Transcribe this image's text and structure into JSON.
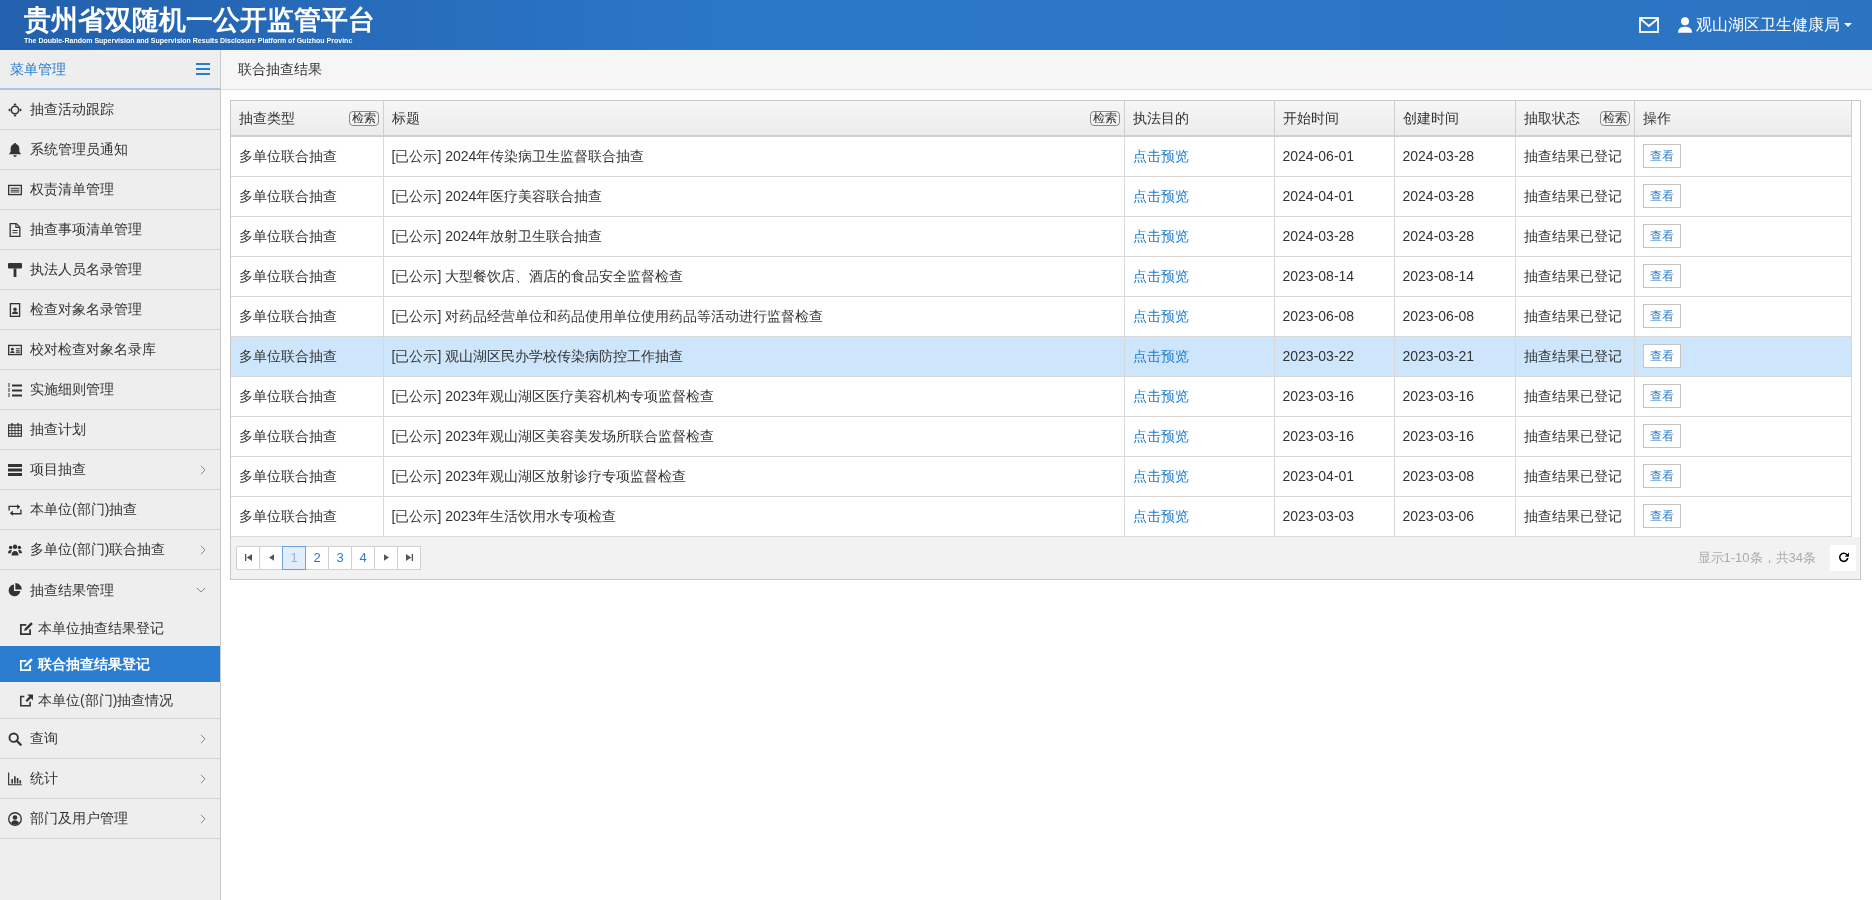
{
  "header": {
    "title": "贵州省双随机一公开监管平台",
    "subtitle": "The Double-Random Supervision and Supervision Results Disclosure Platform of Guizhou Provinc",
    "user": "观山湖区卫生健康局"
  },
  "sidebar": {
    "title": "菜单管理",
    "items": [
      {
        "kind": "link",
        "label": "抽查活动跟踪",
        "selected": false
      },
      {
        "kind": "link",
        "label": "系统管理员通知",
        "selected": false
      },
      {
        "kind": "link",
        "label": "权责清单管理",
        "selected": false
      },
      {
        "kind": "link",
        "label": "抽查事项清单管理",
        "selected": false
      },
      {
        "kind": "link",
        "label": "执法人员名录管理",
        "selected": false
      },
      {
        "kind": "link",
        "label": "检查对象名录管理",
        "selected": false
      },
      {
        "kind": "link",
        "label": "校对检查对象名录库",
        "selected": false
      },
      {
        "kind": "link",
        "label": "实施细则管理",
        "selected": false
      },
      {
        "kind": "link",
        "label": "抽查计划",
        "selected": false
      },
      {
        "kind": "group",
        "label": "项目抽查",
        "selected": false,
        "expanded": false
      },
      {
        "kind": "link",
        "label": "本单位(部门)抽查",
        "selected": false
      },
      {
        "kind": "group",
        "label": "多单位(部门)联合抽查",
        "selected": false,
        "expanded": false
      },
      {
        "kind": "group",
        "label": "抽查结果管理",
        "selected": false,
        "expanded": true,
        "children": [
          {
            "label": "本单位抽查结果登记",
            "selected": false
          },
          {
            "label": "联合抽查结果登记",
            "selected": true
          },
          {
            "label": "本单位(部门)抽查情况",
            "selected": false
          }
        ]
      },
      {
        "kind": "group",
        "label": "查询",
        "selected": false,
        "expanded": false
      },
      {
        "kind": "group",
        "label": "统计",
        "selected": false,
        "expanded": false
      },
      {
        "kind": "group",
        "label": "部门及用户管理",
        "selected": false,
        "expanded": false
      }
    ]
  },
  "breadcrumb": "联合抽查结果",
  "table": {
    "columns": [
      {
        "label": "抽查类型",
        "kind": "text",
        "filter": "检索"
      },
      {
        "label": "标题",
        "kind": "text",
        "filter": "检索"
      },
      {
        "label": "执法目的",
        "kind": "link"
      },
      {
        "label": "开始时间",
        "kind": "text"
      },
      {
        "label": "创建时间",
        "kind": "text"
      },
      {
        "label": "抽取状态",
        "kind": "text",
        "filter": "检索"
      },
      {
        "label": "操作",
        "kind": "button"
      }
    ],
    "rows": [
      {
        "cells": [
          "多单位联合抽查",
          "[已公示] 2024年传染病卫生监督联合抽查",
          "点击预览",
          "2024-06-01",
          "2024-03-28",
          "抽查结果已登记",
          "查看"
        ],
        "selected": false
      },
      {
        "cells": [
          "多单位联合抽查",
          "[已公示] 2024年医疗美容联合抽查",
          "点击预览",
          "2024-04-01",
          "2024-03-28",
          "抽查结果已登记",
          "查看"
        ],
        "selected": false
      },
      {
        "cells": [
          "多单位联合抽查",
          "[已公示] 2024年放射卫生联合抽查",
          "点击预览",
          "2024-03-28",
          "2024-03-28",
          "抽查结果已登记",
          "查看"
        ],
        "selected": false
      },
      {
        "cells": [
          "多单位联合抽查",
          "[已公示] 大型餐饮店、酒店的食品安全监督检查",
          "点击预览",
          "2023-08-14",
          "2023-08-14",
          "抽查结果已登记",
          "查看"
        ],
        "selected": false
      },
      {
        "cells": [
          "多单位联合抽查",
          "[已公示] 对药品经营单位和药品使用单位使用药品等活动进行监督检查",
          "点击预览",
          "2023-06-08",
          "2023-06-08",
          "抽查结果已登记",
          "查看"
        ],
        "selected": false
      },
      {
        "cells": [
          "多单位联合抽查",
          "[已公示] 观山湖区民办学校传染病防控工作抽查",
          "点击预览",
          "2023-03-22",
          "2023-03-21",
          "抽查结果已登记",
          "查看"
        ],
        "selected": true
      },
      {
        "cells": [
          "多单位联合抽查",
          "[已公示] 2023年观山湖区医疗美容机构专项监督检查",
          "点击预览",
          "2023-03-16",
          "2023-03-16",
          "抽查结果已登记",
          "查看"
        ],
        "selected": false
      },
      {
        "cells": [
          "多单位联合抽查",
          "[已公示] 2023年观山湖区美容美发场所联合监督检查",
          "点击预览",
          "2023-03-16",
          "2023-03-16",
          "抽查结果已登记",
          "查看"
        ],
        "selected": false
      },
      {
        "cells": [
          "多单位联合抽查",
          "[已公示] 2023年观山湖区放射诊疗专项监督检查",
          "点击预览",
          "2023-04-01",
          "2023-03-08",
          "抽查结果已登记",
          "查看"
        ],
        "selected": false
      },
      {
        "cells": [
          "多单位联合抽查",
          "[已公示] 2023年生活饮用水专项检查",
          "点击预览",
          "2023-03-03",
          "2023-03-06",
          "抽查结果已登记",
          "查看"
        ],
        "selected": false
      }
    ]
  },
  "pagination": {
    "pages": [
      {
        "label": "1",
        "selected": true
      },
      {
        "label": "2",
        "selected": false
      },
      {
        "label": "3",
        "selected": false
      },
      {
        "label": "4",
        "selected": false
      }
    ],
    "summary": "显示1-10条，共34条"
  }
}
